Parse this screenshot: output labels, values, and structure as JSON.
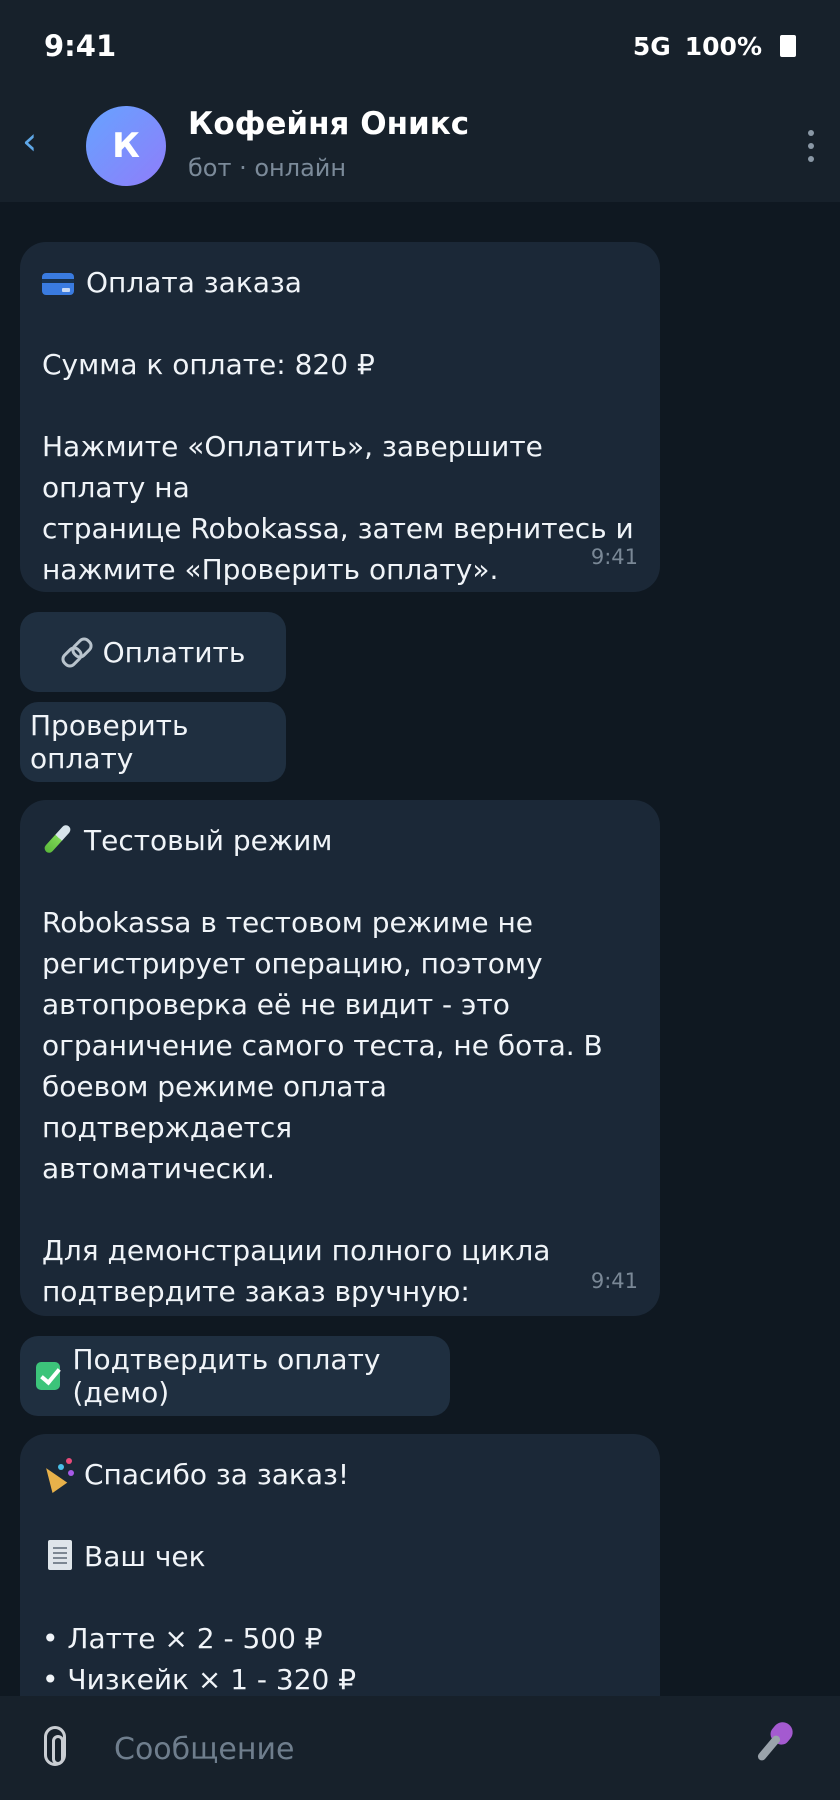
{
  "status_bar": {
    "time": "9:41",
    "network": "5G",
    "battery": "100%"
  },
  "header": {
    "avatar_letter": "К",
    "title": "Кофейня Оникс",
    "subtitle": "бот · онлайн"
  },
  "messages": [
    {
      "icon": "credit-card-icon",
      "title": "Оплата заказа",
      "lines": [
        "Сумма к оплате: 820 ₽",
        "",
        "Нажмите «Оплатить», завершите оплату на",
        "странице Robokassa, затем вернитесь и",
        "нажмите «Проверить оплату»."
      ],
      "time": "9:41"
    },
    {
      "icon": "test-tube-icon",
      "title": "Тестовый режим",
      "lines": [
        "Robokassa в тестовом режиме не",
        "регистрирует операцию, поэтому",
        "автопроверка её не видит - это",
        "ограничение самого теста, не бота. В",
        "боевом режиме оплата подтверждается",
        "автоматически.",
        "",
        "Для демонстрации полного цикла",
        "подтвердите заказ вручную:"
      ],
      "time": "9:41"
    },
    {
      "icon": "party-popper-icon",
      "title": "Спасибо за заказ!",
      "receipt_icon": "receipt-icon",
      "receipt_title": "Ваш чек",
      "items": [
        "• Латте × 2 - 500 ₽",
        "• Чизкейк × 1 - 320 ₽"
      ]
    }
  ],
  "buttons": {
    "pay": {
      "icon": "link-icon",
      "label": "Оплатить"
    },
    "check": {
      "label": "Проверить оплату"
    },
    "confirm_demo": {
      "icon": "check-mark-icon",
      "label": "Подтвердить оплату (демо)"
    }
  },
  "composer": {
    "placeholder": "Сообщение"
  }
}
